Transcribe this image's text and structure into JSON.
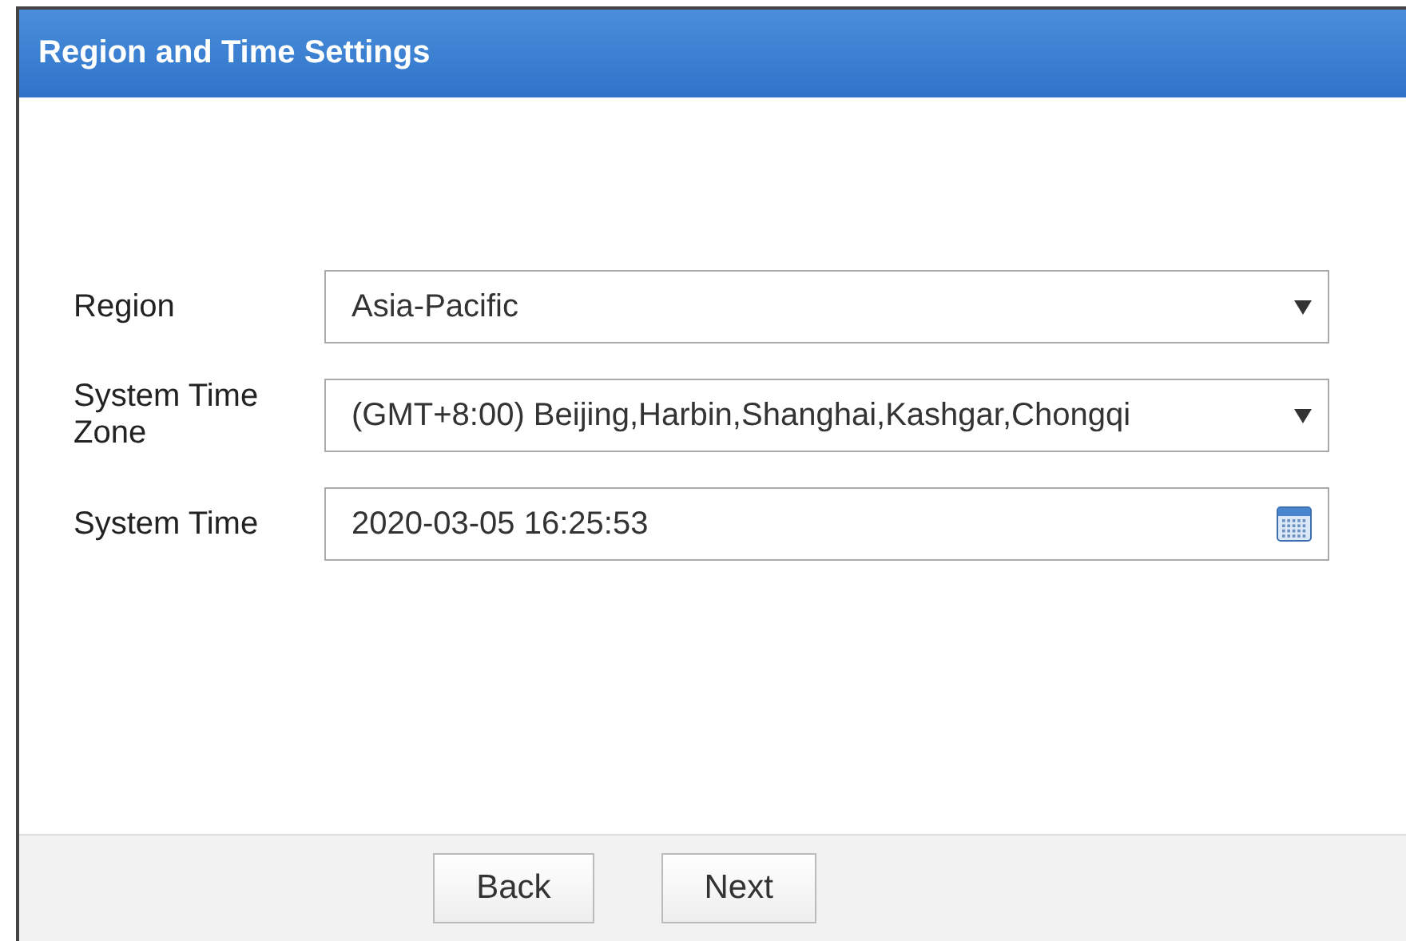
{
  "window": {
    "title": "Region and Time Settings"
  },
  "fields": [
    {
      "kind": "select",
      "label": "Region",
      "value": "Asia-Pacific"
    },
    {
      "kind": "select",
      "label": "System Time Zone",
      "value": "(GMT+8:00) Beijing,Harbin,Shanghai,Kashgar,Chongqi"
    },
    {
      "kind": "date",
      "label": "System Time",
      "value": "2020-03-05 16:25:53"
    }
  ],
  "buttons": [
    {
      "label": "Back"
    },
    {
      "label": "Next"
    }
  ]
}
